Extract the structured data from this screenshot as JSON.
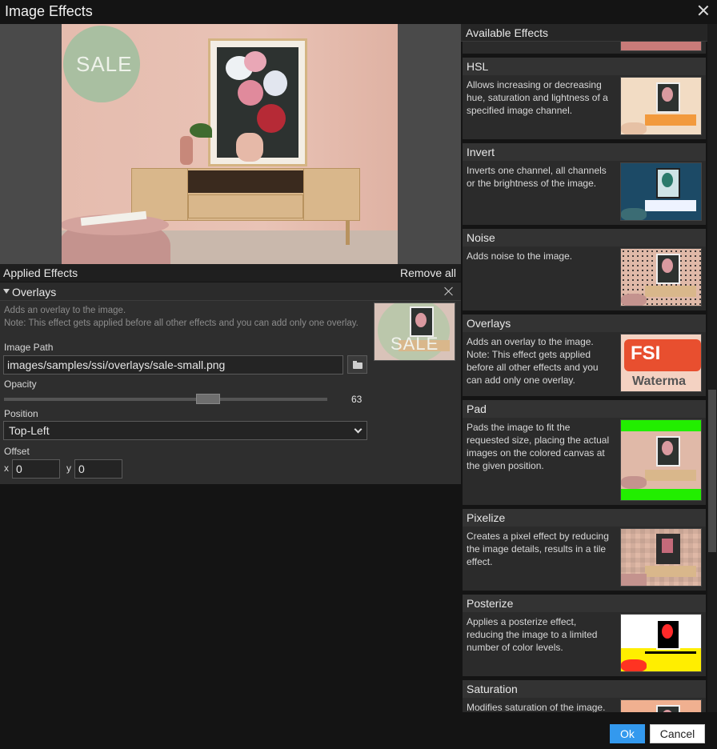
{
  "window": {
    "title": "Image Effects"
  },
  "preview": {
    "overlay_text": "SALE"
  },
  "applied": {
    "header": "Applied Effects",
    "remove_all": "Remove all",
    "effect": {
      "name": "Overlays",
      "description_line1": "Adds an overlay to the image.",
      "description_line2": "Note: This effect gets applied before all other effects and you can add only one overlay.",
      "thumb_text": "SALE",
      "image_path_label": "Image Path",
      "image_path_value": "images/samples/ssi/overlays/sale-small.png",
      "opacity_label": "Opacity",
      "opacity_value": "63",
      "opacity_fraction": 0.63,
      "position_label": "Position",
      "position_value": "Top-Left",
      "offset_label": "Offset",
      "offset_x_label": "x",
      "offset_x_value": "0",
      "offset_y_label": "y",
      "offset_y_value": "0"
    }
  },
  "available": {
    "header": "Available Effects",
    "items": [
      {
        "name": "HSL",
        "description": "Allows increasing or decreasing hue, saturation and lightness of a specified image channel."
      },
      {
        "name": "Invert",
        "description": "Inverts one channel, all channels or the brightness of the image."
      },
      {
        "name": "Noise",
        "description": "Adds noise to the image."
      },
      {
        "name": "Overlays",
        "description": "Adds an overlay to the image. Note: This effect gets applied before all other effects and you can add only one overlay.",
        "thumb_text_1": "FSI",
        "thumb_text_2": "Waterma"
      },
      {
        "name": "Pad",
        "description": "Pads the image to fit the requested size, placing the actual images on the colored canvas at the given position."
      },
      {
        "name": "Pixelize",
        "description": "Creates a pixel effect by reducing the image details, results in a tile effect."
      },
      {
        "name": "Posterize",
        "description": "Applies a posterize effect, reducing the image to a limited number of color levels."
      },
      {
        "name": "Saturation",
        "description": "Modifies saturation of the image."
      }
    ]
  },
  "footer": {
    "ok": "Ok",
    "cancel": "Cancel"
  },
  "colors": {
    "accent": "#3399ee",
    "pad_green": "#22ee00"
  }
}
